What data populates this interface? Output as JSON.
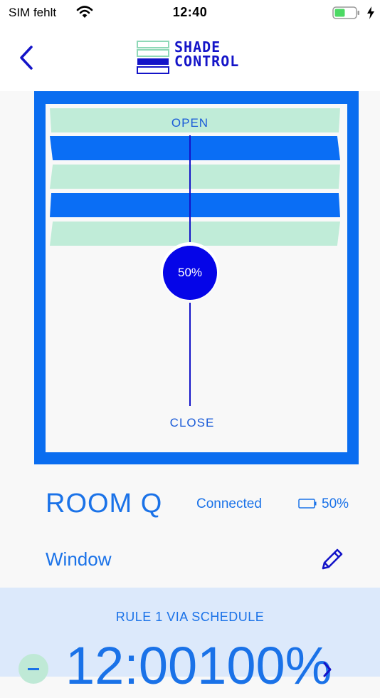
{
  "status_bar": {
    "carrier": "SIM fehlt",
    "time": "12:40",
    "icons": [
      "wifi-icon",
      "battery-icon",
      "charging-bolt-icon"
    ],
    "battery_color": "#4cd964"
  },
  "header": {
    "logo_line1": "SHADE",
    "logo_line2": "CONTROL",
    "back_icon": "chevron-left-icon",
    "brand_color": "#1414c8"
  },
  "shade": {
    "open_label": "OPEN",
    "close_label": "CLOSE",
    "position_label": "50%",
    "position_fraction": 0.5,
    "frame_color": "#0a6df0",
    "slat_light_color": "#c0ecd8",
    "slat_dark_color": "#0a6ef5"
  },
  "room": {
    "name": "ROOM Q",
    "connection_status": "Connected",
    "battery_label": "50%",
    "battery_fraction": 0.5,
    "window_label": "Window",
    "edit_icon": "pencil-icon"
  },
  "rule": {
    "title": "RULE 1 VIA SCHEDULE",
    "time_value": "12:00100%",
    "chevron_icon": "chevron-right-icon",
    "minus_icon": "minus-icon",
    "background_color": "#dce9fb"
  }
}
